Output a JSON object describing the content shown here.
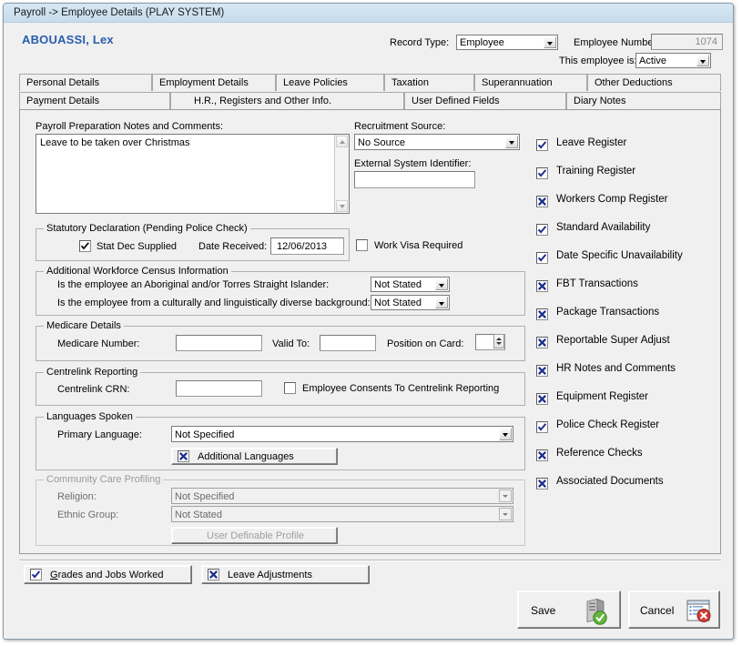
{
  "window": {
    "title": "Payroll -> Employee Details (PLAY SYSTEM)"
  },
  "header": {
    "employee_name": "ABOUASSI, Lex",
    "record_type_label": "Record Type:",
    "record_type_value": "Employee",
    "employee_number_label": "Employee Number:",
    "employee_number_value": "1074",
    "status_label": "This employee is:",
    "status_value": "Active"
  },
  "tabs": {
    "row1": [
      {
        "label": "Personal Details"
      },
      {
        "label": "Employment Details"
      },
      {
        "label": "Leave Policies"
      },
      {
        "label": "Taxation"
      },
      {
        "label": "Superannuation"
      },
      {
        "label": "Other Deductions"
      }
    ],
    "row2": [
      {
        "label": "Payment Details"
      },
      {
        "label": "H.R., Registers and Other Info."
      },
      {
        "label": "User Defined Fields"
      },
      {
        "label": "Diary Notes"
      }
    ],
    "active": "H.R., Registers and Other Info."
  },
  "notes": {
    "label": "Payroll Preparation Notes and Comments:",
    "value": "Leave to be taken over Christmas"
  },
  "statutory": {
    "title": "Statutory Declaration (Pending Police Check)",
    "stat_dec_label": "Stat Dec Supplied",
    "stat_dec_checked": true,
    "date_received_label": "Date Received:",
    "date_received_value": "12/06/2013"
  },
  "recruitment": {
    "source_label": "Recruitment Source:",
    "source_value": "No Source",
    "external_id_label": "External System Identifier:",
    "external_id_value": "",
    "work_visa_label": "Work Visa Required",
    "work_visa_checked": false
  },
  "census": {
    "title": "Additional Workforce Census Information",
    "q1_label": "Is the employee an Aboriginal and/or Torres Straight Islander:",
    "q1_value": "Not Stated",
    "q2_label": "Is the employee from a culturally and linguistically diverse background:",
    "q2_value": "Not Stated"
  },
  "medicare": {
    "title": "Medicare Details",
    "number_label": "Medicare Number:",
    "number_value": "",
    "valid_to_label": "Valid To:",
    "valid_to_value": "",
    "position_label": "Position on Card:",
    "position_value": ""
  },
  "centrelink": {
    "title": "Centrelink Reporting",
    "crn_label": "Centrelink CRN:",
    "crn_value": "",
    "consent_label": "Employee Consents To Centrelink Reporting",
    "consent_checked": false
  },
  "languages": {
    "title": "Languages Spoken",
    "primary_label": "Primary Language:",
    "primary_value": "Not Specified",
    "additional_button": "Additional Languages",
    "additional_mark": "x"
  },
  "community_care": {
    "title": "Community Care Profiling",
    "religion_label": "Religion:",
    "religion_value": "Not Specified",
    "ethnic_label": "Ethnic Group:",
    "ethnic_value": "Not Stated",
    "profile_button": "User Definable Profile",
    "disabled": true
  },
  "registers": [
    {
      "label": "Leave Register",
      "mark": "check"
    },
    {
      "label": "Training Register",
      "mark": "check"
    },
    {
      "label": "Workers Comp Register",
      "mark": "x"
    },
    {
      "label": "Standard Availability",
      "mark": "check"
    },
    {
      "label": "Date Specific Unavailability",
      "mark": "check"
    },
    {
      "label": "FBT Transactions",
      "mark": "x"
    },
    {
      "label": "Package Transactions",
      "mark": "x"
    },
    {
      "label": "Reportable Super Adjust",
      "mark": "x"
    },
    {
      "label": "HR Notes and Comments",
      "mark": "x"
    },
    {
      "label": "Equipment Register",
      "mark": "x"
    },
    {
      "label": "Police Check Register",
      "mark": "check"
    },
    {
      "label": "Reference Checks",
      "mark": "x"
    },
    {
      "label": "Associated Documents",
      "mark": "x"
    }
  ],
  "footer": {
    "grades_button_accel": "G",
    "grades_button_rest": "rades and Jobs Worked",
    "grades_mark": "check",
    "leave_adj_button": "Leave Adjustments",
    "leave_adj_mark": "x",
    "save_button": "Save",
    "cancel_button": "Cancel"
  },
  "colors": {
    "accent": "#2a5db0",
    "titlebar": "#cfe2f0",
    "mark_blue": "#1d2f8f",
    "face": "#f0f0f0"
  }
}
